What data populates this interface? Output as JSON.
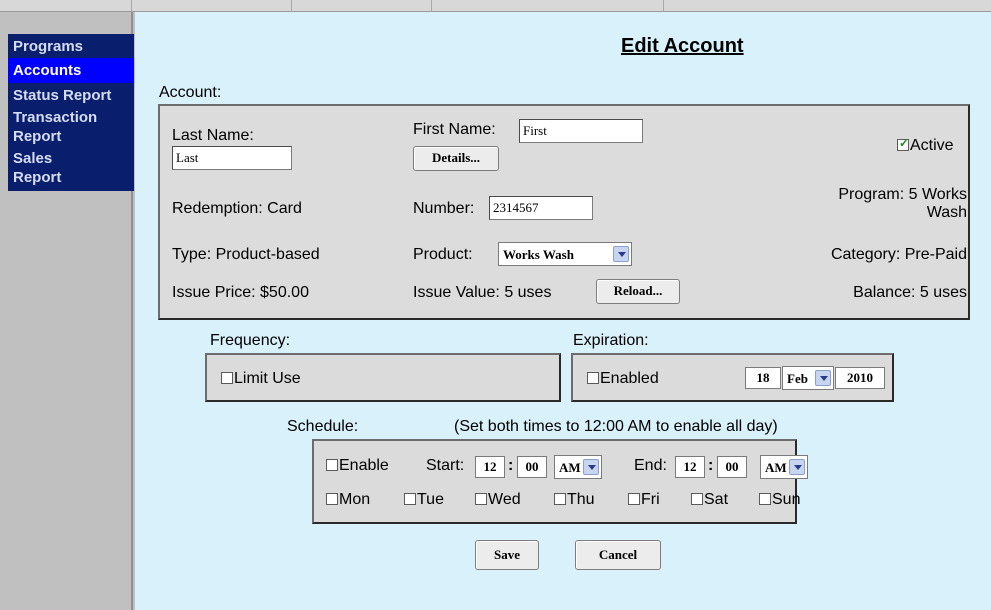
{
  "nav": {
    "items": [
      "Programs",
      "Accounts",
      "Status Report",
      "Transaction Report",
      "Sales Report"
    ],
    "active": "Accounts"
  },
  "page": {
    "title": "Edit Account"
  },
  "account": {
    "section_label": "Account:",
    "last_name_label": "Last Name:",
    "last_name_value": "Last",
    "first_name_label": "First Name:",
    "first_name_value": "First",
    "details_button": "Details...",
    "active_label": "Active",
    "active_checked": true,
    "redemption": "Redemption: Card",
    "number_label": "Number:",
    "number_value": "2314567",
    "program_line1": "Program: 5 Works",
    "program_line2": "Wash",
    "type": "Type: Product-based",
    "product_label": "Product:",
    "product_value": "Works Wash",
    "category": "Category: Pre-Paid",
    "issue_price": "Issue Price: $50.00",
    "issue_value": "Issue Value: 5 uses",
    "reload_button": "Reload...",
    "balance": "Balance: 5 uses"
  },
  "frequency": {
    "label": "Frequency:",
    "limit_use": "Limit Use"
  },
  "expiration": {
    "label": "Expiration:",
    "enabled": "Enabled",
    "day": "18",
    "month": "Feb",
    "year": "2010"
  },
  "schedule": {
    "label": "Schedule:",
    "hint": "(Set both times to 12:00 AM to enable all day)",
    "enable": "Enable",
    "start_label": "Start:",
    "start_hour": "12",
    "start_min": "00",
    "start_ampm": "AM",
    "end_label": "End:",
    "end_hour": "12",
    "end_min": "00",
    "end_ampm": "AM",
    "colon": ":",
    "days": [
      "Mon",
      "Tue",
      "Wed",
      "Thu",
      "Fri",
      "Sat",
      "Sun"
    ]
  },
  "actions": {
    "save": "Save",
    "cancel": "Cancel"
  },
  "colors": {
    "nav_bg": "#0a1e6e",
    "nav_active": "#0000ff",
    "main_bg": "#d9f1fa",
    "box_bg": "#dcdcdc"
  }
}
